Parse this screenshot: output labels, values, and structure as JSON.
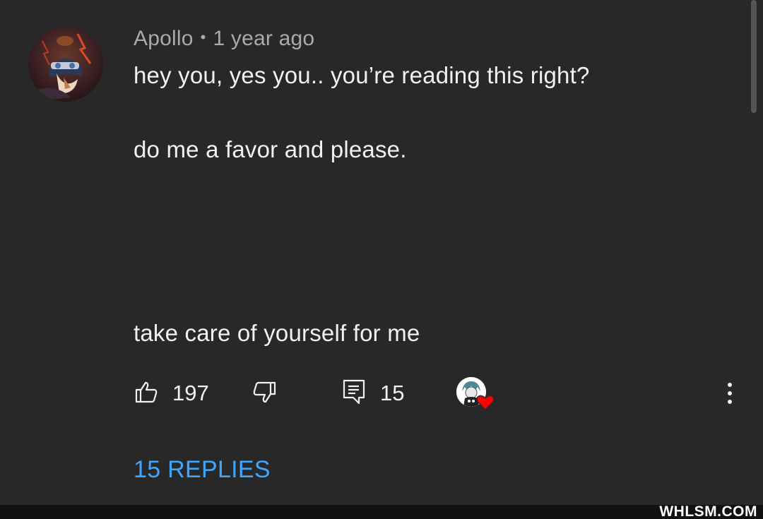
{
  "comment": {
    "author": "Apollo",
    "separator": "•",
    "timestamp": "1 year ago",
    "text_lines": [
      "hey you, yes you.. you’re reading this right?",
      "do me a favor and please.",
      "take care of yourself for me"
    ]
  },
  "actions": {
    "like_count": "197",
    "reply_count": "15",
    "icons": {
      "like": "thumbs-up-icon",
      "dislike": "thumbs-down-icon",
      "reply": "reply-icon",
      "more": "more-vert-icon",
      "creator_heart": "heart-icon"
    }
  },
  "replies": {
    "label": "15 REPLIES"
  },
  "watermark": "WHLSM.COM",
  "colors": {
    "background": "#282828",
    "text": "#f1f1f1",
    "meta": "#aaaaaa",
    "link": "#3ea6ff",
    "heart": "#ff0000"
  }
}
